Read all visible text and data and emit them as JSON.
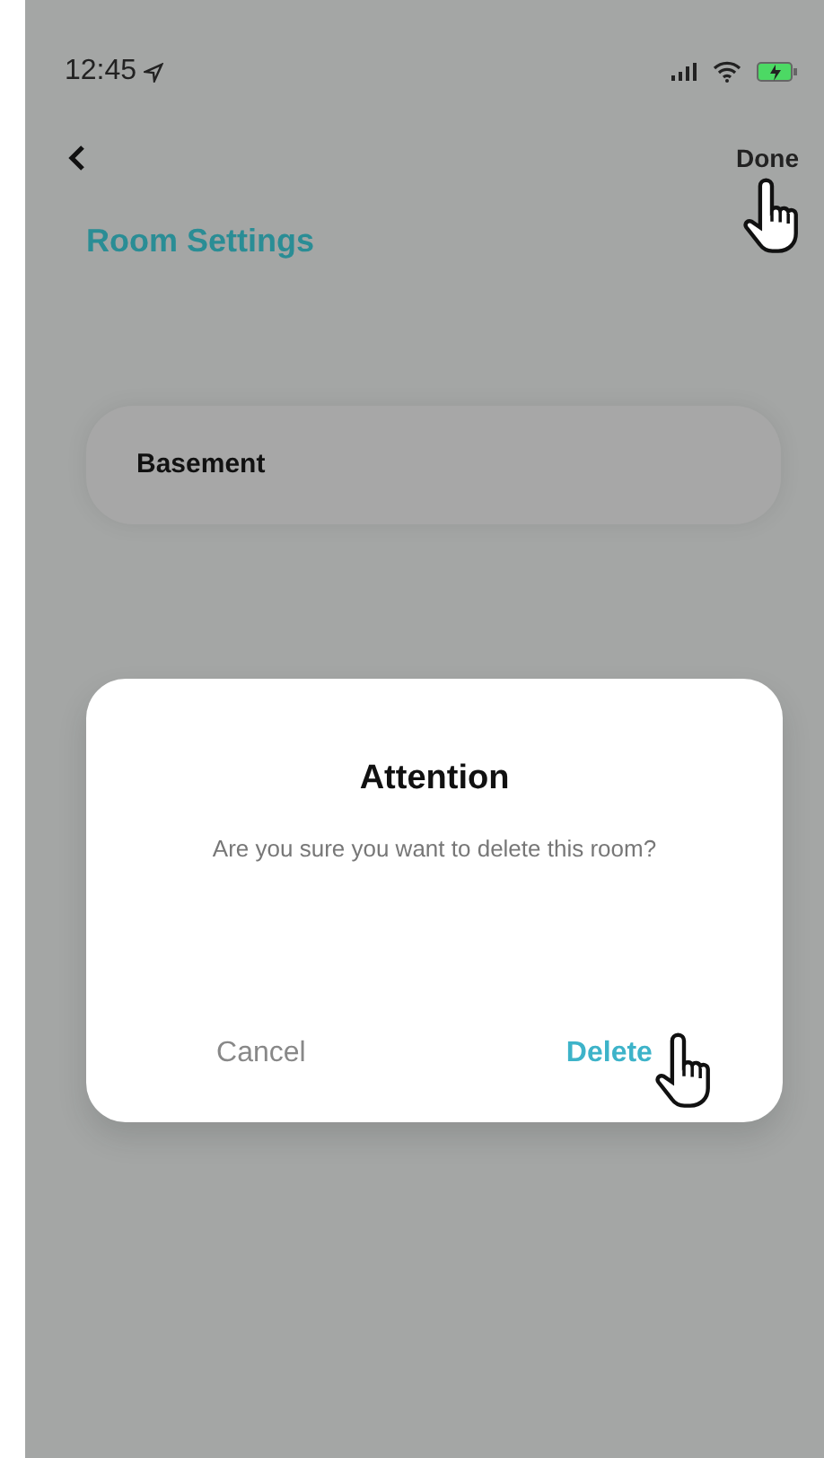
{
  "status_bar": {
    "time": "12:45"
  },
  "nav": {
    "done_label": "Done"
  },
  "title": "Room Settings",
  "room_name": {
    "value": "Basement"
  },
  "dialog": {
    "title": "Attention",
    "message": "Are you sure you want to delete this room?",
    "buttons": [
      {
        "label": "Cancel",
        "kind": "cancel"
      },
      {
        "label": "Delete",
        "kind": "primary"
      }
    ]
  }
}
